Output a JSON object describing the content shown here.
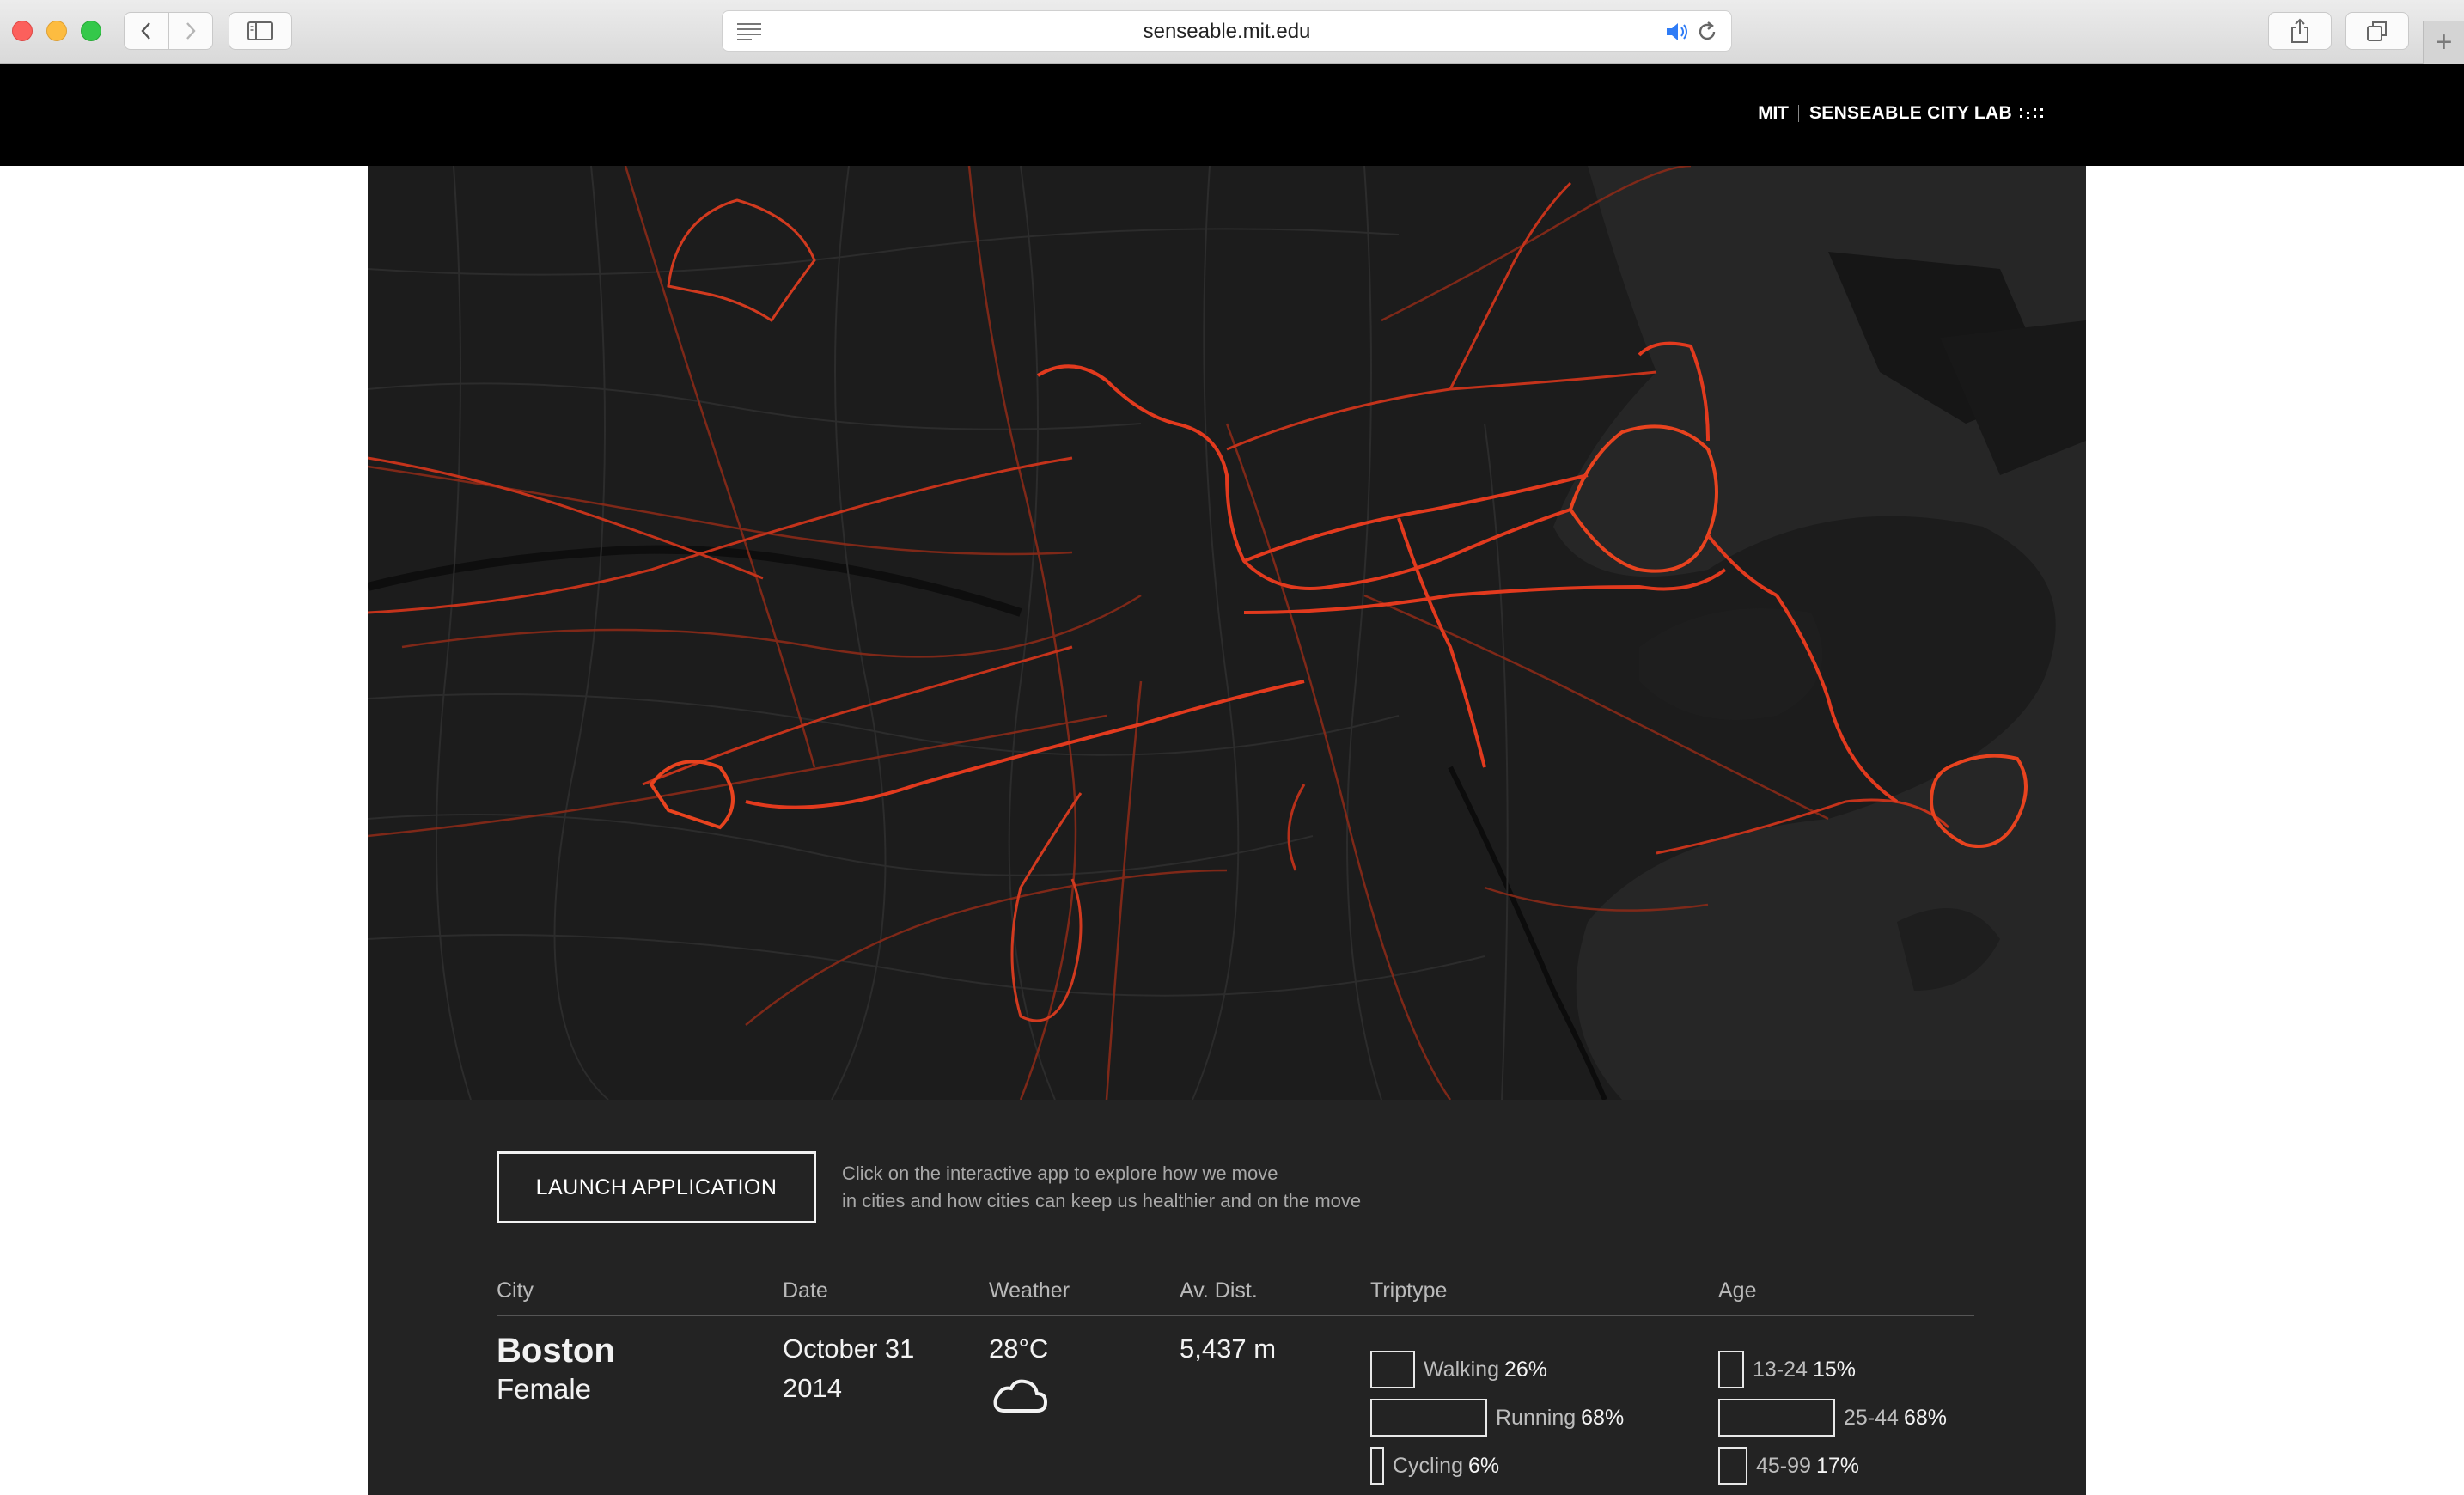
{
  "browser": {
    "url": "senseable.mit.edu"
  },
  "header": {
    "brand_mit": "MIT",
    "brand_lab": "SENSEABLE CITY LAB"
  },
  "map": {
    "route_color": "#e23a1e",
    "background_color": "#1c1c1c",
    "water_color": "#2a2a2a"
  },
  "panel": {
    "launch_label": "LAUNCH APPLICATION",
    "description_line1": "Click on the interactive app to explore how we move",
    "description_line2": "in cities and how cities can keep us healthier and on the move",
    "columns": {
      "city": "City",
      "date": "Date",
      "weather": "Weather",
      "distance": "Av. Dist.",
      "triptype": "Triptype",
      "age": "Age"
    },
    "values": {
      "city": "Boston",
      "gender": "Female",
      "date_line1": "October 31",
      "date_line2": "2014",
      "temperature": "28°C",
      "weather_icon": "cloud-icon",
      "distance": "5,437 m"
    },
    "triptypes": [
      {
        "label": "Walking",
        "percent": "26%",
        "share": 0.26
      },
      {
        "label": "Running",
        "percent": "68%",
        "share": 0.68
      },
      {
        "label": "Cycling",
        "percent": "6%",
        "share": 0.06
      }
    ],
    "ages": [
      {
        "label": "13-24",
        "percent": "15%",
        "share": 0.15
      },
      {
        "label": "25-44",
        "percent": "68%",
        "share": 0.68
      },
      {
        "label": "45-99",
        "percent": "17%",
        "share": 0.17
      }
    ]
  }
}
